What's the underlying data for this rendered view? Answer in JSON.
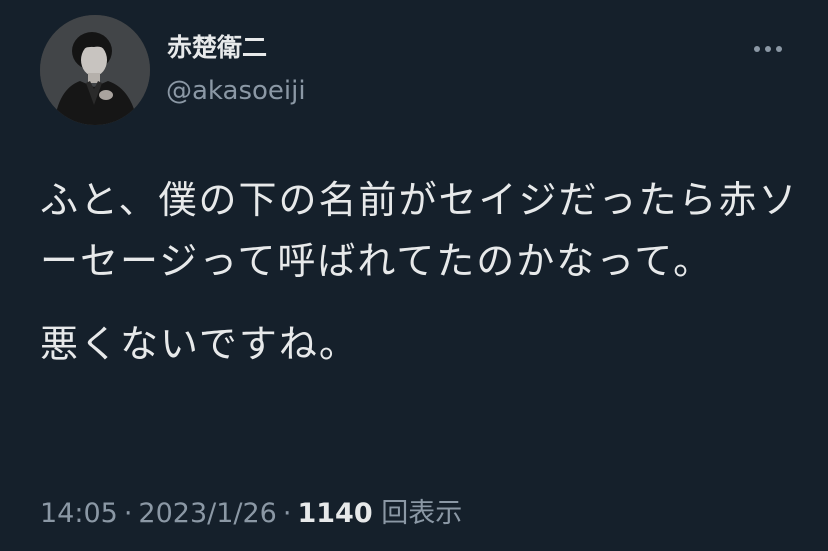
{
  "author": {
    "display_name": "赤楚衛二",
    "handle": "@akasoeiji"
  },
  "tweet": {
    "paragraphs": [
      "ふと、僕の下の名前がセイジだったら赤ソーセージって呼ばれてたのかなって。",
      "悪くないですね。"
    ],
    "time": "14:05",
    "separator": "·",
    "date": "2023/1/26",
    "views_count": "1140",
    "views_label": "回表示"
  },
  "icons": {
    "more": "more-horizontal-icon",
    "avatar": "profile-photo"
  },
  "colors": {
    "background": "#15202b",
    "primary_text": "#e7e9ea",
    "secondary_text": "#8b98a5"
  }
}
